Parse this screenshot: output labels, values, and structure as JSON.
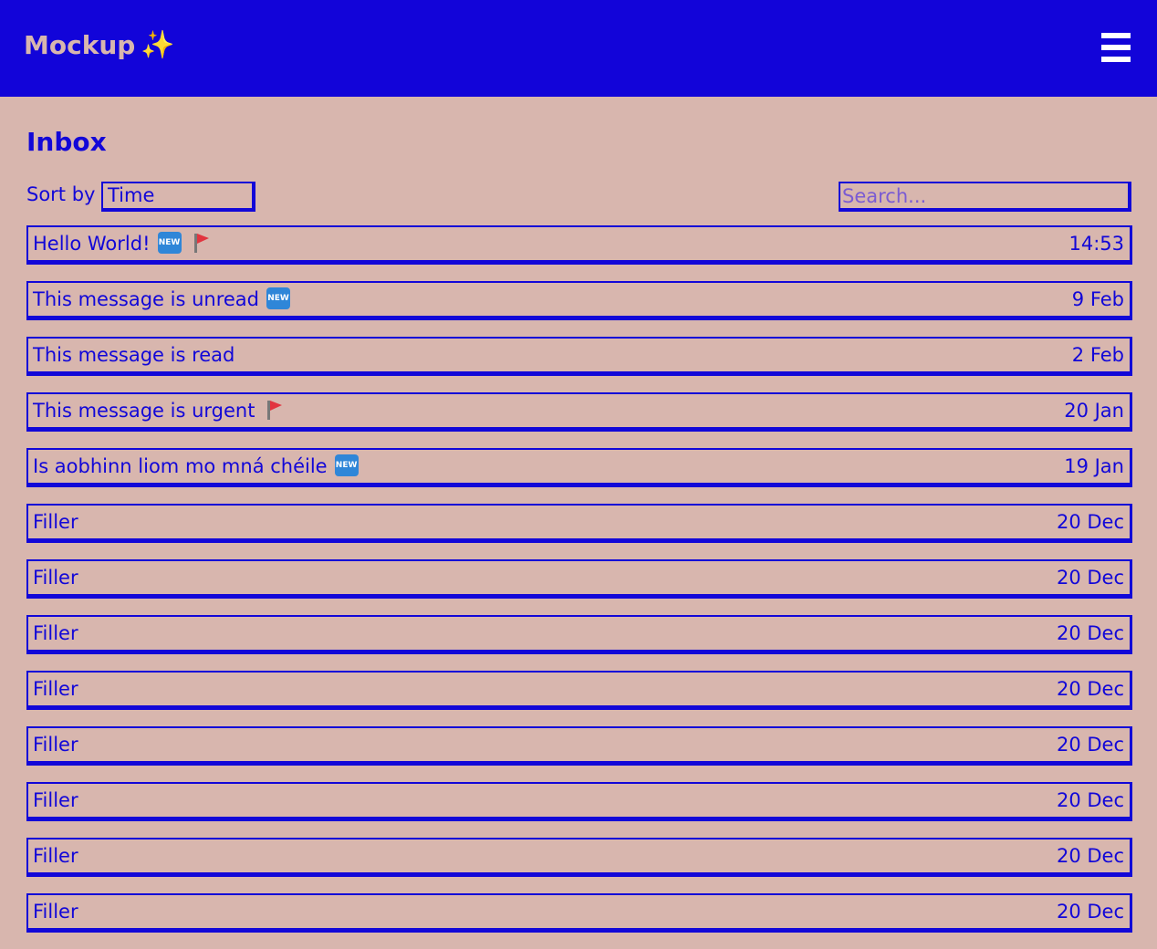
{
  "header": {
    "brand": "Mockup",
    "brand_icon": "sparkles-icon",
    "menu_icon": "hamburger-menu-icon",
    "background_color": "#1204d9"
  },
  "page": {
    "title": "Inbox",
    "background_color": "#d8b6ae",
    "text_color": "#1207d8"
  },
  "sort": {
    "label": "Sort by",
    "value": "Time"
  },
  "search": {
    "placeholder": "Search...",
    "value": ""
  },
  "badges": {
    "new_label": "NEW",
    "new_color": "#2f86d8",
    "flag_color": "#e2343f"
  },
  "messages": [
    {
      "subject": "Hello World!",
      "date": "14:53",
      "new": true,
      "flagged": true
    },
    {
      "subject": "This message is unread",
      "date": "9 Feb",
      "new": true,
      "flagged": false
    },
    {
      "subject": "This message is read",
      "date": "2 Feb",
      "new": false,
      "flagged": false
    },
    {
      "subject": "This message is urgent",
      "date": "20 Jan",
      "new": false,
      "flagged": true
    },
    {
      "subject": "Is aobhinn liom mo mná chéile",
      "date": "19 Jan",
      "new": true,
      "flagged": false
    },
    {
      "subject": "Filler",
      "date": "20 Dec",
      "new": false,
      "flagged": false
    },
    {
      "subject": "Filler",
      "date": "20 Dec",
      "new": false,
      "flagged": false
    },
    {
      "subject": "Filler",
      "date": "20 Dec",
      "new": false,
      "flagged": false
    },
    {
      "subject": "Filler",
      "date": "20 Dec",
      "new": false,
      "flagged": false
    },
    {
      "subject": "Filler",
      "date": "20 Dec",
      "new": false,
      "flagged": false
    },
    {
      "subject": "Filler",
      "date": "20 Dec",
      "new": false,
      "flagged": false
    },
    {
      "subject": "Filler",
      "date": "20 Dec",
      "new": false,
      "flagged": false
    },
    {
      "subject": "Filler",
      "date": "20 Dec",
      "new": false,
      "flagged": false
    }
  ]
}
